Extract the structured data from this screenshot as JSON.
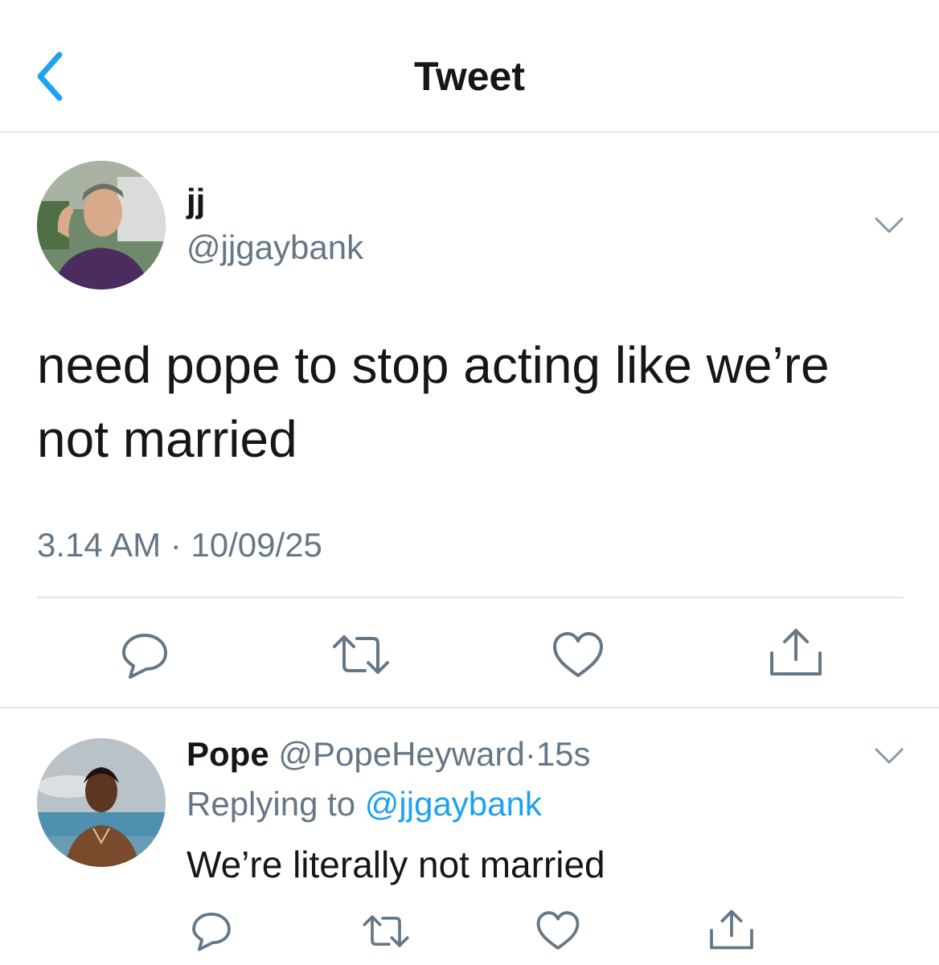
{
  "colors": {
    "accent": "#1da1f2",
    "text_primary": "#14171a",
    "text_secondary": "#657786",
    "divider": "#e1e4e6"
  },
  "navbar": {
    "title": "Tweet",
    "back_icon": "chevron-left-icon"
  },
  "tweet": {
    "author_name": "jj",
    "author_handle": "@jjgaybank",
    "text": "need pope to stop acting like we’re not married",
    "timestamp": "3.14 AM · 10/09/25",
    "menu_icon": "chevron-down-icon",
    "actions": [
      "reply-icon",
      "retweet-icon",
      "like-icon",
      "share-icon"
    ]
  },
  "reply": {
    "author_name": "Pope",
    "author_handle": "@PopeHeyward",
    "separator": "·",
    "age": "15s",
    "replying_prefix": "Replying to",
    "replying_to": "@jjgaybank",
    "text": "We’re literally not married",
    "menu_icon": "chevron-down-icon",
    "actions": [
      "reply-icon",
      "retweet-icon",
      "like-icon",
      "share-icon"
    ]
  }
}
